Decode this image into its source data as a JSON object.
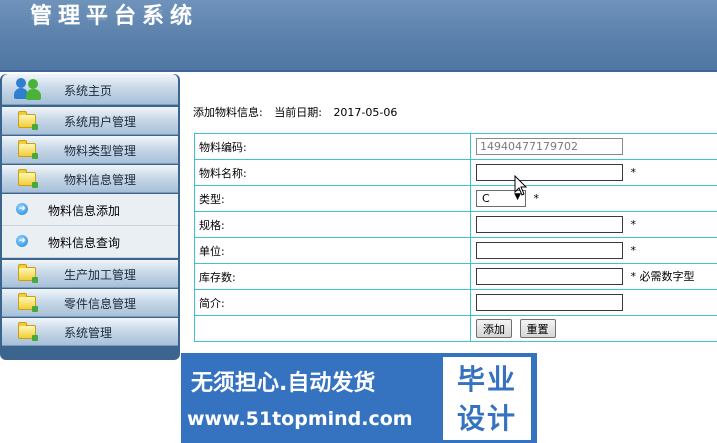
{
  "header": {
    "title": "管理平台系统"
  },
  "sidebar": {
    "home": "系统主页",
    "items": [
      {
        "label": "系统用户管理"
      },
      {
        "label": "物料类型管理"
      },
      {
        "label": "物料信息管理"
      }
    ],
    "subitems": [
      {
        "label": "物料信息添加"
      },
      {
        "label": "物料信息查询"
      }
    ],
    "items_after": [
      {
        "label": "生产加工管理"
      },
      {
        "label": "零件信息管理"
      },
      {
        "label": "系统管理"
      }
    ]
  },
  "main": {
    "section_title": "添加物料信息:",
    "date_label": "当前日期:",
    "date_value": "2017-05-06",
    "fields": [
      {
        "label": "物料编码:",
        "value": "14940477179702"
      },
      {
        "label": "物料名称:",
        "value": "",
        "required": "*"
      },
      {
        "label": "类型:",
        "value": "C",
        "required": "*"
      },
      {
        "label": "规格:",
        "value": "",
        "required": "*"
      },
      {
        "label": "单位:",
        "value": "",
        "required": "*"
      },
      {
        "label": "库存数:",
        "value": "",
        "required": "*",
        "hint": "必需数字型"
      },
      {
        "label": "简介:",
        "value": ""
      }
    ],
    "add_button": "添加",
    "reset_button": "重置"
  },
  "watermark": {
    "slogan": "无须担心.自动发货",
    "site": "www.51topmind.com",
    "badge_line1": "毕业",
    "badge_line2": "设计"
  },
  "colors": {
    "header": "#5a80ab",
    "sidebar": "#3b648f",
    "table_border": "#41c4c9",
    "watermark": "#3573c1"
  }
}
